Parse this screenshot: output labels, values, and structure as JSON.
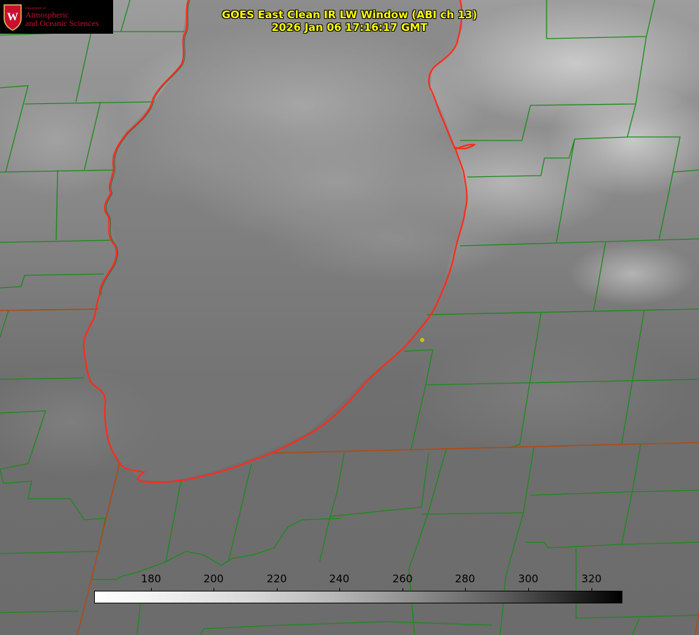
{
  "header": {
    "title_line1": "GOES East Clean IR LW Window (ABI ch 13)",
    "title_line2": "2026 Jan 06 17:16:17 GMT"
  },
  "logo": {
    "dept": "Department of",
    "line1": "Atmospheric",
    "line2": "and Oceanic Sciences",
    "crest_letter": "W"
  },
  "colorbar": {
    "ticks": [
      "180",
      "200",
      "220",
      "240",
      "260",
      "280",
      "300",
      "320"
    ],
    "colors": {
      "low": "#ffffff",
      "high": "#000000"
    }
  },
  "map": {
    "lake_outline_color": "#ff2a1a",
    "county_line_color": "#1a8a1a",
    "state_line_color": "#b04a10",
    "marker_color": "#d4c000"
  }
}
